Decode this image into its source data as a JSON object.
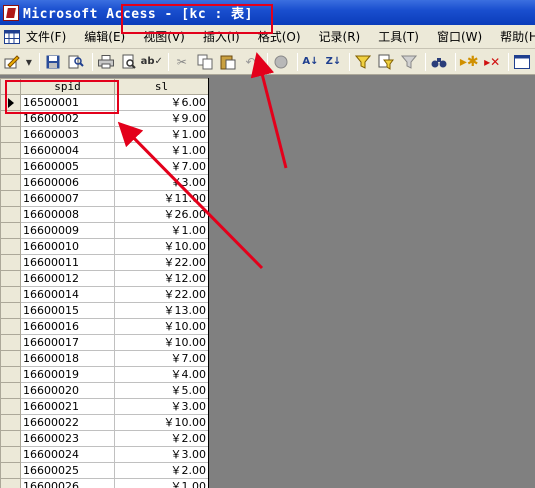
{
  "window": {
    "title": "Microsoft Access - [kc : 表]"
  },
  "menubar": {
    "items": [
      {
        "label": "文件(F)"
      },
      {
        "label": "编辑(E)"
      },
      {
        "label": "视图(V)"
      },
      {
        "label": "插入(I)"
      },
      {
        "label": "格式(O)"
      },
      {
        "label": "记录(R)"
      },
      {
        "label": "工具(T)"
      },
      {
        "label": "窗口(W)"
      },
      {
        "label": "帮助(H)"
      }
    ]
  },
  "toolbar": {
    "icons": [
      "design-view-icon",
      "save-icon",
      "print-icon",
      "print-preview-icon",
      "spelling-icon",
      "cut-icon",
      "copy-icon",
      "paste-icon",
      "undo-icon",
      "hyperlink-icon",
      "sort-ascending-icon",
      "sort-descending-icon",
      "filter-by-selection-icon",
      "filter-by-form-icon",
      "apply-filter-icon",
      "find-icon",
      "new-record-icon",
      "delete-record-icon",
      "database-window-icon"
    ]
  },
  "table": {
    "columns": [
      "spid",
      "sl"
    ],
    "rows": [
      [
        "16500001",
        "￥6.00"
      ],
      [
        "16600002",
        "￥9.00"
      ],
      [
        "16600003",
        "￥1.00"
      ],
      [
        "16600004",
        "￥1.00"
      ],
      [
        "16600005",
        "￥7.00"
      ],
      [
        "16600006",
        "￥3.00"
      ],
      [
        "16600007",
        "￥11.00"
      ],
      [
        "16600008",
        "￥26.00"
      ],
      [
        "16600009",
        "￥1.00"
      ],
      [
        "16600010",
        "￥10.00"
      ],
      [
        "16600011",
        "￥22.00"
      ],
      [
        "16600012",
        "￥12.00"
      ],
      [
        "16600014",
        "￥22.00"
      ],
      [
        "16600015",
        "￥13.00"
      ],
      [
        "16600016",
        "￥10.00"
      ],
      [
        "16600017",
        "￥10.00"
      ],
      [
        "16600018",
        "￥7.00"
      ],
      [
        "16600019",
        "￥4.00"
      ],
      [
        "16600020",
        "￥5.00"
      ],
      [
        "16600021",
        "￥3.00"
      ],
      [
        "16600022",
        "￥10.00"
      ],
      [
        "16600023",
        "￥2.00"
      ],
      [
        "16600024",
        "￥3.00"
      ],
      [
        "16600025",
        "￥2.00"
      ],
      [
        "16600026",
        "￥1.00"
      ]
    ],
    "current_row": 0
  },
  "colors": {
    "annotation": "#e3001b",
    "workspace": "#808080",
    "titlebar": "#0a3cba"
  }
}
